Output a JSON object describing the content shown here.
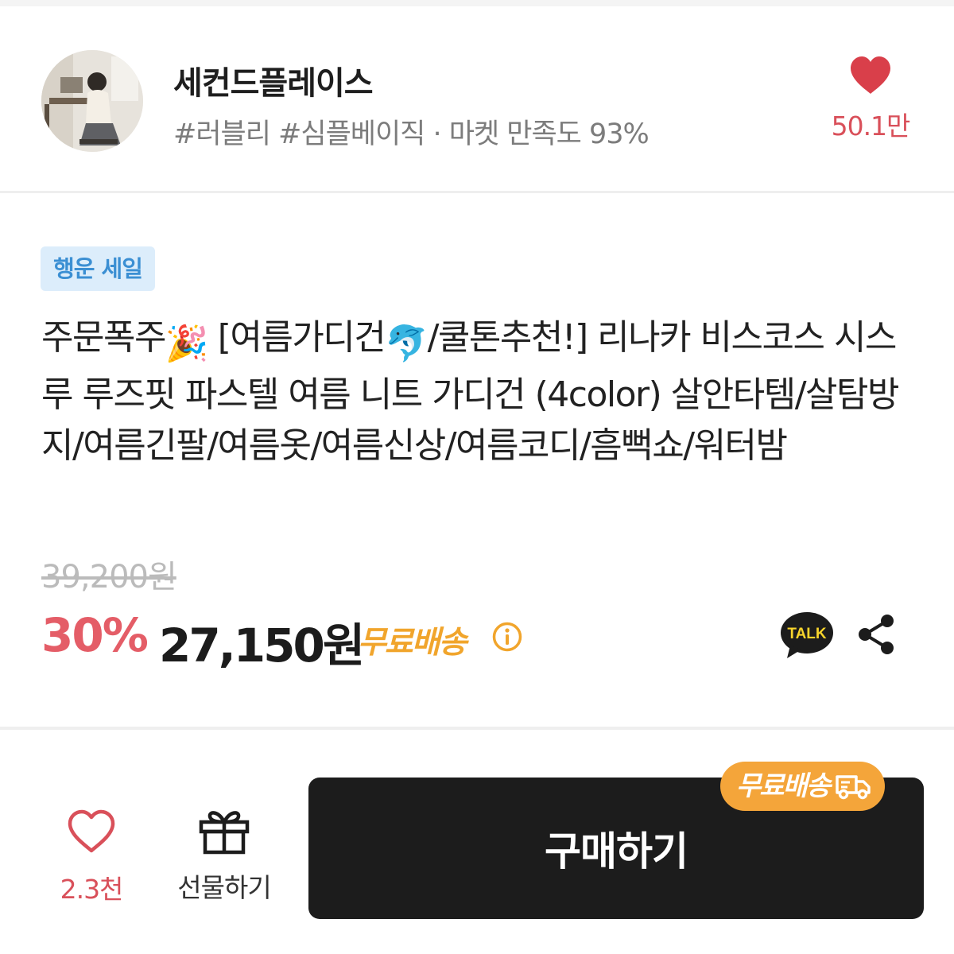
{
  "shop": {
    "name": "세컨드플레이스",
    "tags": "#러블리 #심플베이직 · 마켓 만족도 93%",
    "likes": "50.1만"
  },
  "product": {
    "badge": "행운 세일",
    "title_part1": "주문폭주",
    "title_emoji1": "🎉",
    "title_part2": " [여름가디건",
    "title_emoji2": "🐬",
    "title_part3": "/쿨톤추천!] 리나카 비스코스 시스루 루즈핏 파스텔 여름 니트 가디건 (4color) 살안타템/살탐방지/여름긴팔/여름옷/여름신상/여름코디/흠뻑쇼/워터밤",
    "original_price": "39,200원",
    "discount": "30%",
    "price": "27,150원",
    "shipping": "무료배송",
    "talk_label": "TALK"
  },
  "bottom_bar": {
    "like_count": "2.3천",
    "gift_label": "선물하기",
    "buy_label": "구매하기",
    "shipping_tag": "무료배송"
  },
  "colors": {
    "accent_red": "#e45d67",
    "shipping_orange": "#f1a52c",
    "badge_bg": "#dcedfb",
    "badge_text": "#3b8fd3",
    "buy_bg": "#1c1c1c"
  }
}
